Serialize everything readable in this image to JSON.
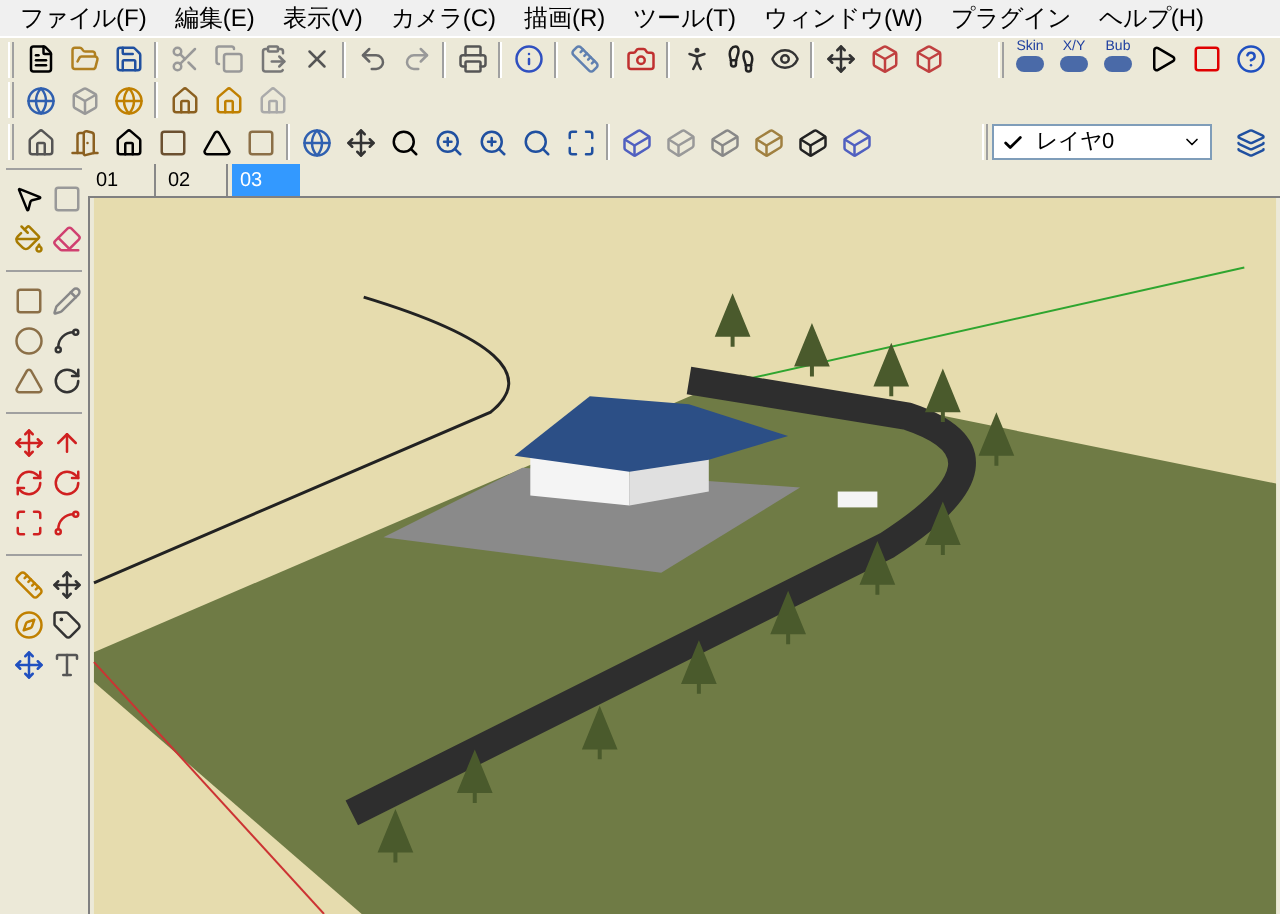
{
  "menu_bar": [
    "ファイル(F)",
    "編集(E)",
    "表示(V)",
    "カメラ(C)",
    "描画(R)",
    "ツール(T)",
    "ウィンドウ(W)",
    "プラグイン",
    "ヘルプ(H)"
  ],
  "plugin_buttons": [
    "Skin",
    "X/Y",
    "Bub"
  ],
  "layer_dropdown": {
    "value": "レイヤ0",
    "current": true
  },
  "scene_tabs": [
    {
      "label": "01",
      "selected": false
    },
    {
      "label": "02",
      "selected": false
    },
    {
      "label": "03",
      "selected": true
    }
  ]
}
